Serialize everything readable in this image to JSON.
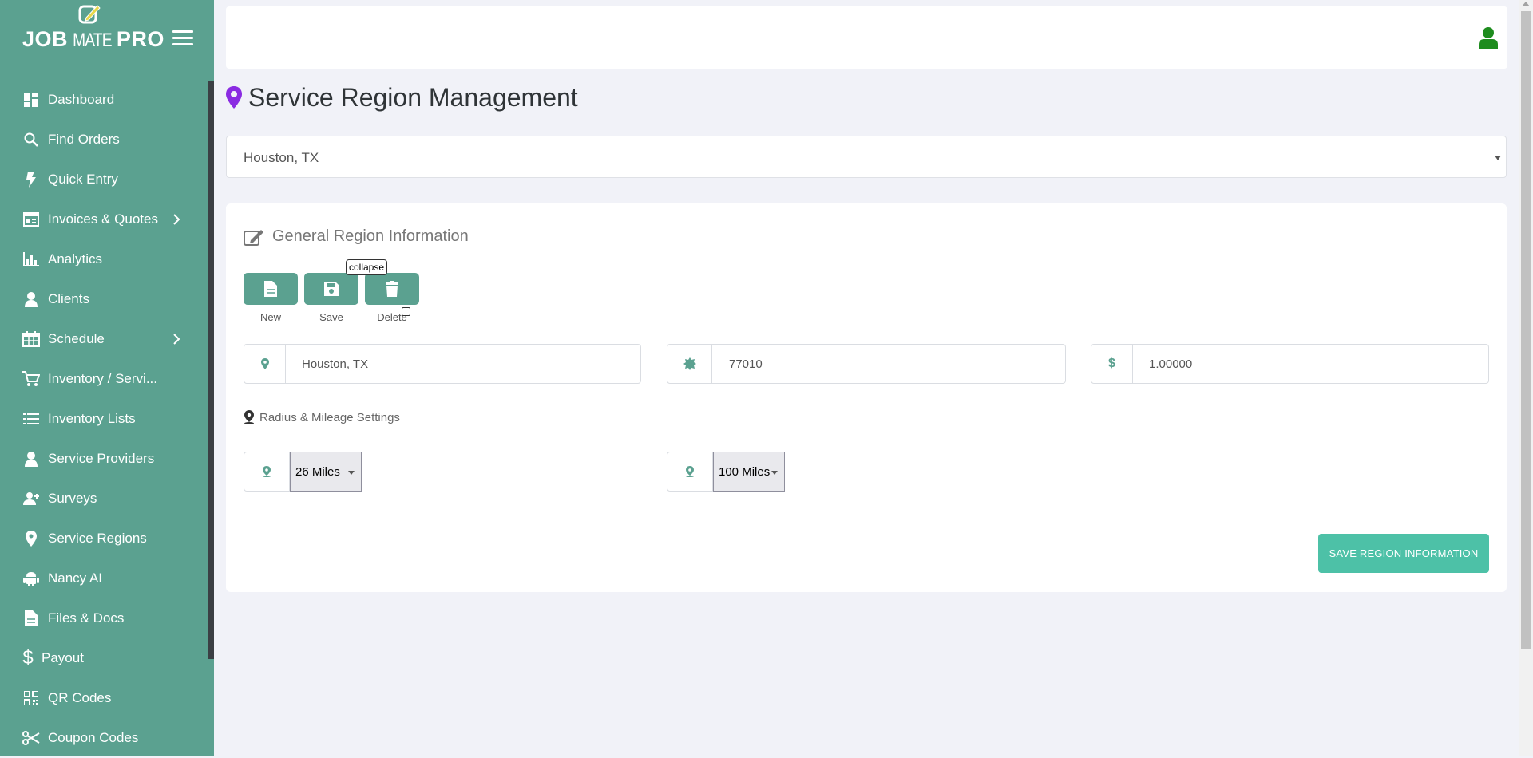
{
  "brand": {
    "left": "JOB",
    "middle": "MATE",
    "right": "PRO"
  },
  "sidebar": {
    "items": [
      {
        "label": "Dashboard",
        "icon": "dashboard-icon"
      },
      {
        "label": "Find Orders",
        "icon": "search-icon"
      },
      {
        "label": "Quick Entry",
        "icon": "lightning-icon"
      },
      {
        "label": "Invoices & Quotes",
        "icon": "invoice-icon",
        "expandable": true
      },
      {
        "label": "Analytics",
        "icon": "bar-chart-icon"
      },
      {
        "label": "Clients",
        "icon": "user-icon"
      },
      {
        "label": "Schedule",
        "icon": "calendar-icon",
        "expandable": true
      },
      {
        "label": "Inventory / Servi...",
        "icon": "cart-icon"
      },
      {
        "label": "Inventory Lists",
        "icon": "list-icon"
      },
      {
        "label": "Service Providers",
        "icon": "user-icon"
      },
      {
        "label": "Surveys",
        "icon": "user-add-icon"
      },
      {
        "label": "Service Regions",
        "icon": "map-pin-icon"
      },
      {
        "label": "Nancy AI",
        "icon": "android-icon"
      },
      {
        "label": "Files & Docs",
        "icon": "file-icon"
      },
      {
        "label": "Payout",
        "icon": "dollar-icon"
      },
      {
        "label": "QR Codes",
        "icon": "qr-icon"
      },
      {
        "label": "Coupon Codes",
        "icon": "scissors-icon"
      }
    ]
  },
  "page": {
    "title": "Service Region Management"
  },
  "region_select": {
    "value": "Houston, TX"
  },
  "card": {
    "heading": "General Region Information",
    "buttons": {
      "new": "New",
      "save": "Save",
      "delete": "Delete"
    },
    "tooltip": "collapse",
    "fields": {
      "region_name": "Houston, TX",
      "zip_code": "77010",
      "multiplier": "1.00000"
    },
    "radius_heading": "Radius & Mileage Settings",
    "radius_select": "26 Miles",
    "mileage_select": "100 Miles",
    "save_region_label": "SAVE REGION INFORMATION"
  },
  "colors": {
    "sidebar": "#5ba190",
    "accent": "#4dc1a7",
    "pin": "#8a2be2",
    "user_icon": "#1e8c1e"
  }
}
